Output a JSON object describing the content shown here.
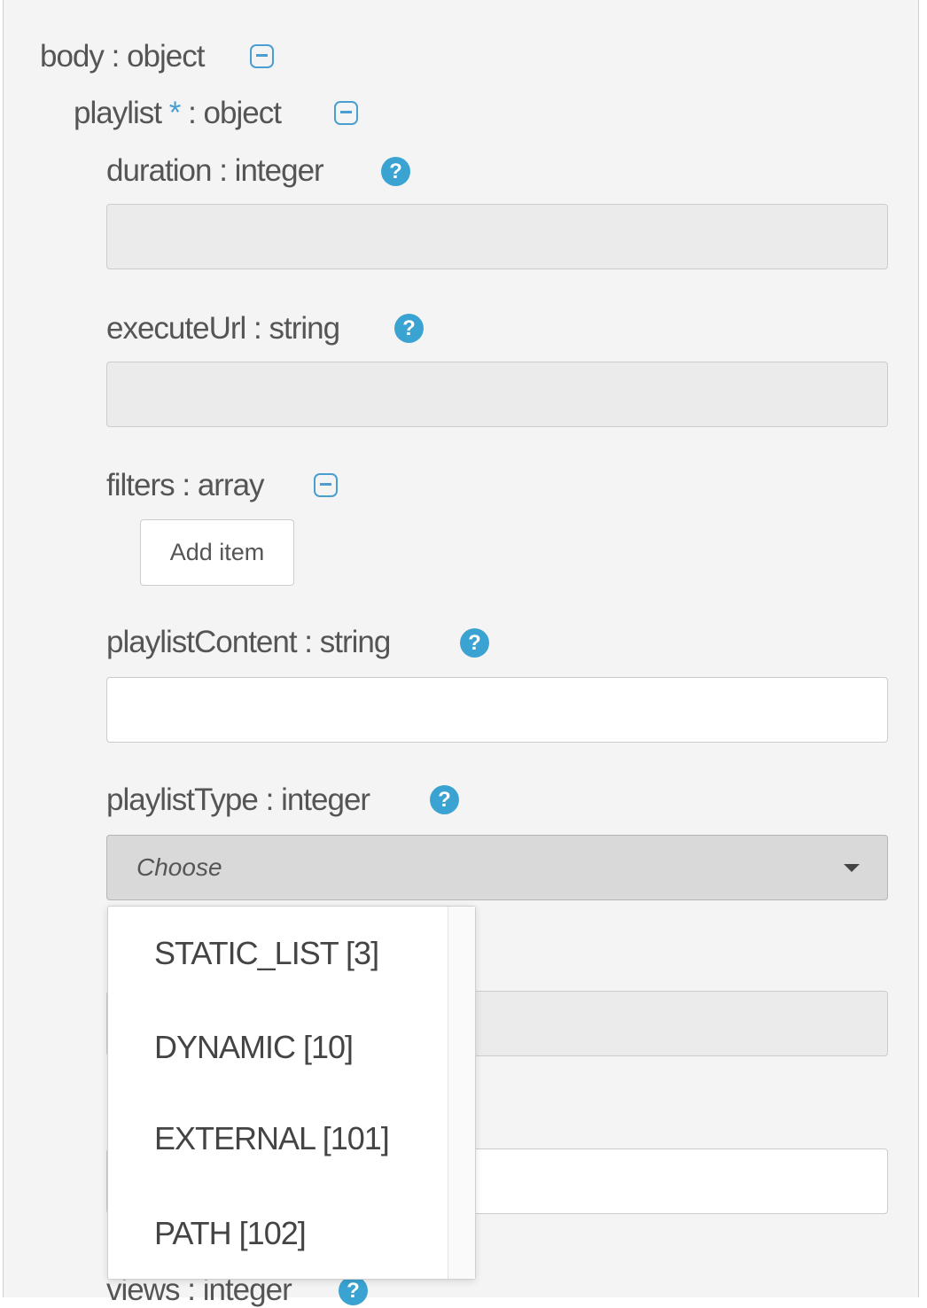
{
  "body": {
    "name": "body",
    "type": "object"
  },
  "playlist": {
    "name": "playlist",
    "required_marker": "*",
    "type": "object"
  },
  "fields": {
    "duration": {
      "name": "duration",
      "type": "integer"
    },
    "executeUrl": {
      "name": "executeUrl",
      "type": "string"
    },
    "filters": {
      "name": "filters",
      "type": "array",
      "add_item_label": "Add item"
    },
    "playlistContent": {
      "name": "playlistContent",
      "type": "string"
    },
    "playlistType": {
      "name": "playlistType",
      "type": "integer",
      "placeholder": "Choose"
    },
    "views": {
      "name": "views",
      "type": "integer"
    }
  },
  "dropdown_options": [
    "STATIC_LIST [3]",
    "DYNAMIC [10]",
    "EXTERNAL [101]",
    "PATH [102]"
  ],
  "icons": {
    "collapse": "collapse-minus-icon",
    "help": "help-question-icon",
    "dropdown": "caret-down-icon"
  },
  "colors": {
    "accent": "#4a9fd0",
    "panel_bg": "#f4f4f4",
    "disabled_field": "#ebebeb"
  }
}
